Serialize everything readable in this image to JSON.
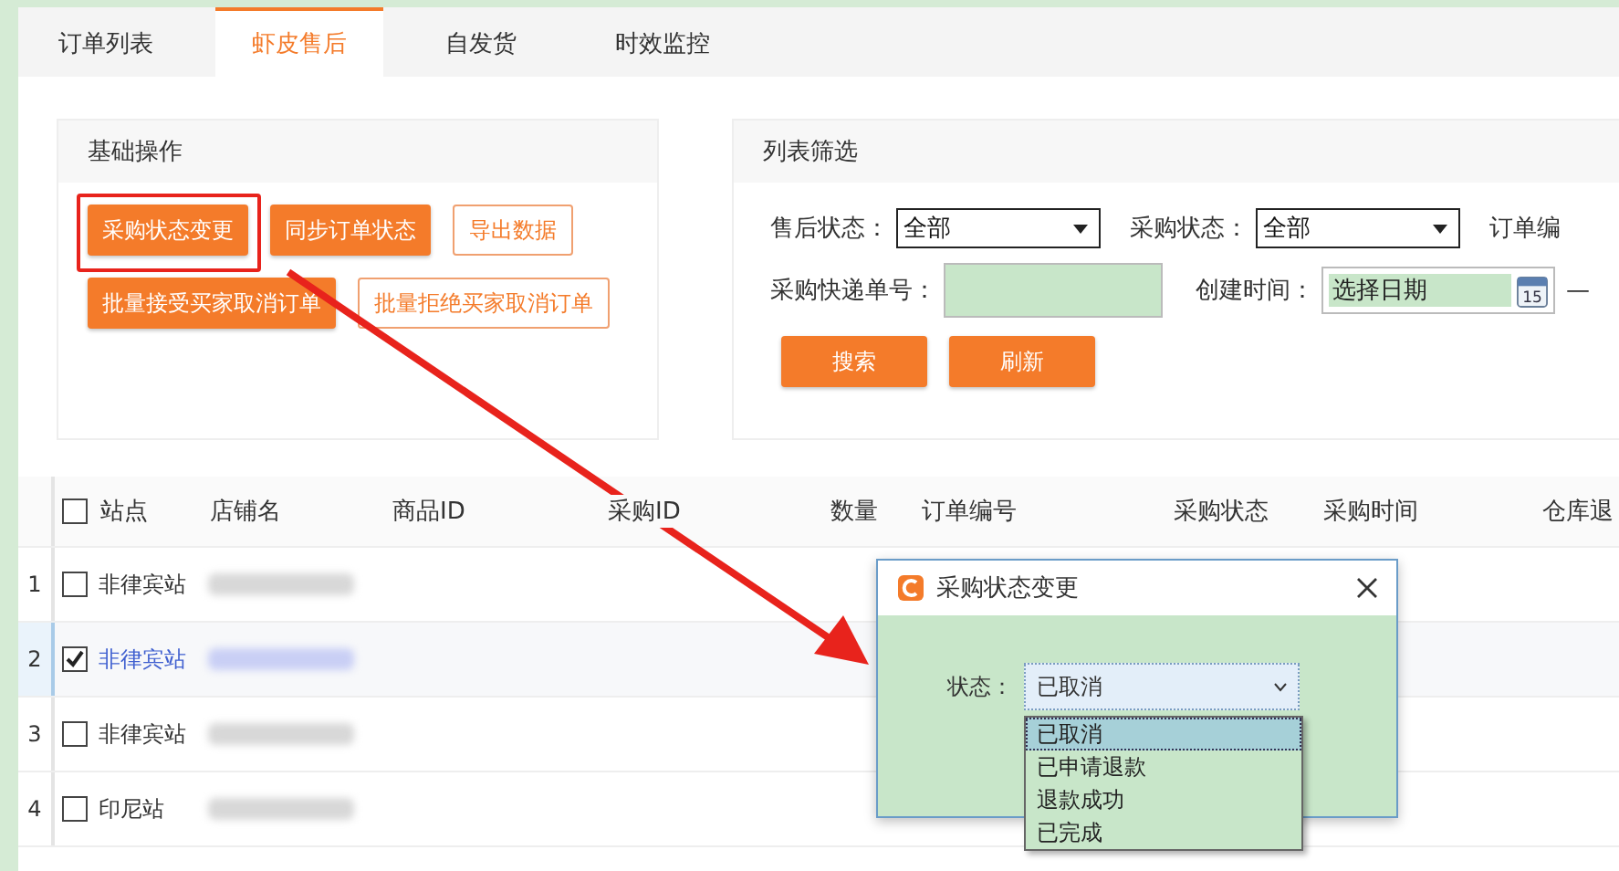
{
  "tabs": [
    {
      "label": "订单列表",
      "selected": false
    },
    {
      "label": "虾皮售后",
      "selected": true
    },
    {
      "label": "自发货",
      "selected": false
    },
    {
      "label": "时效监控",
      "selected": false
    }
  ],
  "actions_panel": {
    "title": "基础操作",
    "button_rows": [
      [
        {
          "label": "采购状态变更",
          "kind": "primary",
          "highlighted": true
        },
        {
          "label": "同步订单状态",
          "kind": "primary",
          "highlighted": false
        },
        {
          "label": "导出数据",
          "kind": "outline",
          "highlighted": false
        }
      ],
      [
        {
          "label": "批量接受买家取消订单",
          "kind": "primary",
          "highlighted": false
        },
        {
          "label": "批量拒绝买家取消订单",
          "kind": "outline",
          "highlighted": false
        }
      ]
    ]
  },
  "filter_panel": {
    "title": "列表筛选",
    "lines": [
      {
        "fields": [
          {
            "kind": "select",
            "label": "售后状态：",
            "value": "全部"
          },
          {
            "kind": "select",
            "label": "采购状态：",
            "value": "全部"
          },
          {
            "kind": "label",
            "label": "订单编"
          }
        ]
      },
      {
        "fields": [
          {
            "kind": "text",
            "label": "采购快递单号："
          },
          {
            "kind": "date",
            "label": "创建时间：",
            "placeholder": "选择日期",
            "calendar_day": "15"
          },
          {
            "kind": "dash",
            "label": "—"
          }
        ]
      }
    ],
    "buttons": [
      "搜索",
      "刷新"
    ]
  },
  "table": {
    "header_checked": false,
    "columns": [
      "站点",
      "店铺名",
      "商品ID",
      "采购ID",
      "数量",
      "订单编号",
      "采购状态",
      "采购时间",
      "仓库退"
    ],
    "rows": [
      {
        "number": "1",
        "site": "非律宾站",
        "checked": false,
        "selected": false
      },
      {
        "number": "2",
        "site": "非律宾站",
        "checked": true,
        "selected": true
      },
      {
        "number": "3",
        "site": "非律宾站",
        "checked": false,
        "selected": false
      },
      {
        "number": "4",
        "site": "印尼站",
        "checked": false,
        "selected": false
      }
    ]
  },
  "dialog": {
    "title": "采购状态变更",
    "field_label": "状态：",
    "value": "已取消",
    "options": [
      {
        "label": "已取消",
        "selected": true
      },
      {
        "label": "已申请退款",
        "selected": false
      },
      {
        "label": "退款成功",
        "selected": false
      },
      {
        "label": "已完成",
        "selected": false
      }
    ]
  }
}
